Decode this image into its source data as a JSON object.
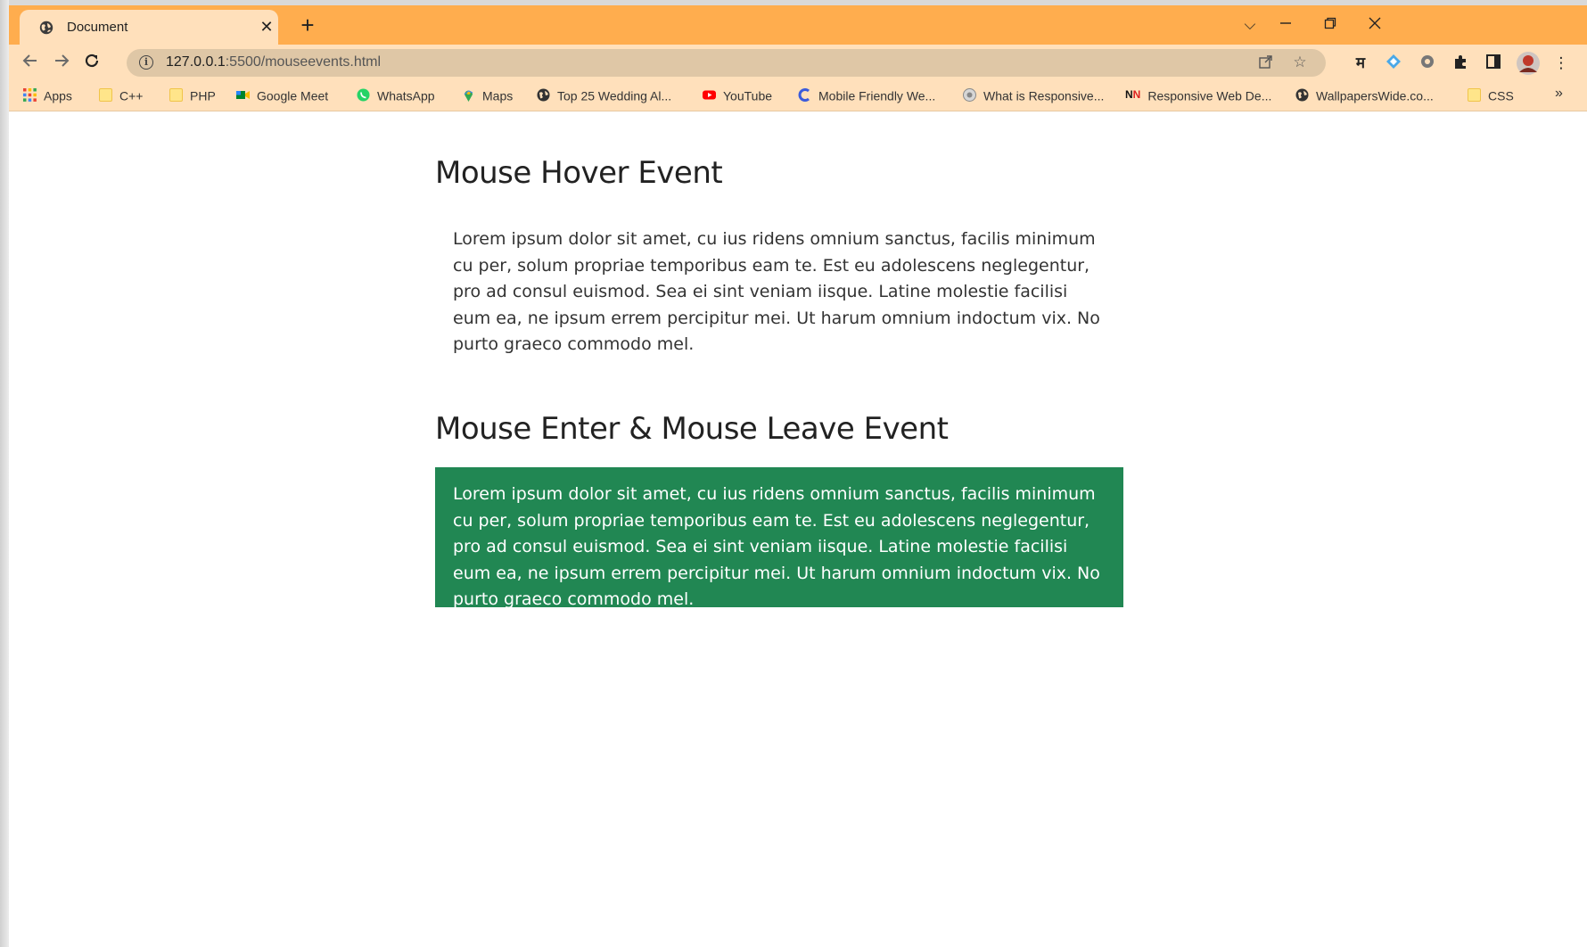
{
  "browser": {
    "tab": {
      "title": "Document",
      "icon": "globe-icon"
    },
    "address": {
      "host": "127.0.0.1",
      "port_path": ":5500/mouseevents.html"
    },
    "bookmarks": [
      {
        "label": "Apps",
        "icon": "apps-grid-icon"
      },
      {
        "label": "C++",
        "icon": "folder-icon"
      },
      {
        "label": "PHP",
        "icon": "folder-icon"
      },
      {
        "label": "Google Meet",
        "icon": "google-meet-icon"
      },
      {
        "label": "WhatsApp",
        "icon": "whatsapp-icon"
      },
      {
        "label": "Maps",
        "icon": "maps-pin-icon"
      },
      {
        "label": "Top 25 Wedding Al...",
        "icon": "globe-icon"
      },
      {
        "label": "YouTube",
        "icon": "youtube-icon"
      },
      {
        "label": "Mobile Friendly We...",
        "icon": "site-c-icon"
      },
      {
        "label": "What is Responsive...",
        "icon": "site-icon"
      },
      {
        "label": "Responsive Web De...",
        "icon": "nn-icon"
      },
      {
        "label": "WallpapersWide.co...",
        "icon": "globe-icon"
      },
      {
        "label": "CSS",
        "icon": "folder-icon"
      }
    ],
    "extension_letter": "म"
  },
  "page": {
    "section1": {
      "heading": "Mouse Hover Event",
      "text": "Lorem ipsum dolor sit amet, cu ius ridens omnium sanctus, facilis minimum cu per, solum propriae temporibus eam te. Est eu adolescens neglegentur, pro ad consul euismod. Sea ei sint veniam iisque. Latine molestie facilisi eum ea, ne ipsum errem percipitur mei. Ut harum omnium indoctum vix. No purto graeco commodo mel."
    },
    "section2": {
      "heading": "Mouse Enter & Mouse Leave Event",
      "text": "Lorem ipsum dolor sit amet, cu ius ridens omnium sanctus, facilis minimum cu per, solum propriae temporibus eam te. Est eu adolescens neglegentur, pro ad consul euismod. Sea ei sint veniam iisque. Latine molestie facilisi eum ea, ne ipsum errem percipitur mei. Ut harum omnium indoctum vix. No purto graeco commodo mel."
    }
  },
  "colors": {
    "tabstrip": "#ffad4e",
    "toolbar": "#ffe0bb",
    "highlight_box": "#218753"
  }
}
